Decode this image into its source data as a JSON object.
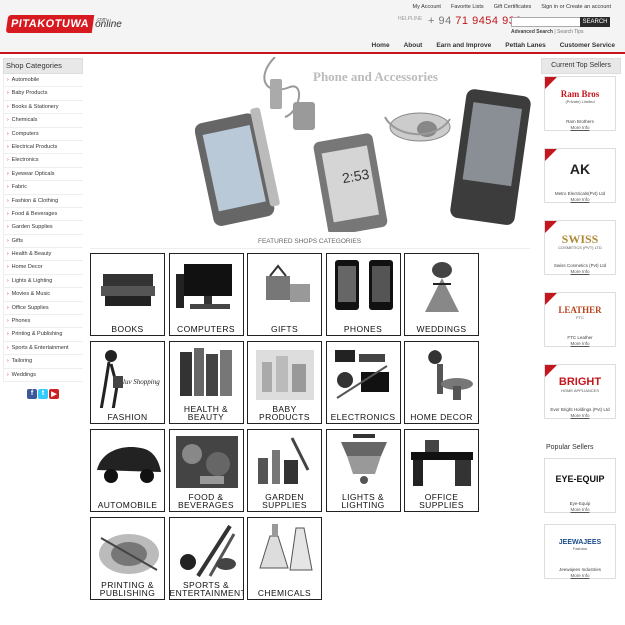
{
  "header": {
    "logo_main": "PITAKOTUWA",
    "logo_sub": "online",
    "logo_com": ".com",
    "top_links": [
      "My Account",
      "Favorite Lists",
      "Gift Certificates",
      "Sign in or Create an account"
    ],
    "helpline_label": "HELPLINE",
    "phone_plus": "+ 94",
    "phone_number": "71 9454 930",
    "search_placeholder": "",
    "search_button": "SEARCH",
    "advanced_search": "Advanced Search",
    "search_tips": "| Search Tips"
  },
  "nav": [
    "Home",
    "About",
    "Earn and Improve",
    "Pettah Lanes",
    "Customer Service"
  ],
  "sidebar": {
    "title": "Shop Categories",
    "items": [
      "Automobile",
      "Baby Products",
      "Books & Stationery",
      "Chemicals",
      "Computers",
      "Electrical Products",
      "Electronics",
      "Eyewear Opticals",
      "Fabric",
      "Fashion & Clothing",
      "Food & Beverages",
      "Garden Supplies",
      "Gifts",
      "Health & Beauty",
      "Home Decor",
      "Lights & Lighting",
      "Movies & Music",
      "Office Supplies",
      "Phones",
      "Printing & Publishing",
      "Sports & Entertainment",
      "Tailoring",
      "Weddings"
    ],
    "social": [
      {
        "icon": "facebook-icon",
        "glyph": "f",
        "color": "#3b5998"
      },
      {
        "icon": "twitter-icon",
        "glyph": "t",
        "color": "#33ccff"
      },
      {
        "icon": "youtube-icon",
        "glyph": "▶",
        "color": "#cc2222"
      }
    ]
  },
  "banner": {
    "title": "Phone and Accessories"
  },
  "featured": {
    "title": "FEATURED SHOPS CATEGORIES"
  },
  "tiles": [
    {
      "l1": "BOOKS",
      "l2": ""
    },
    {
      "l1": "COMPUTERS",
      "l2": ""
    },
    {
      "l1": "GIFTS",
      "l2": ""
    },
    {
      "l1": "PHONES",
      "l2": ""
    },
    {
      "l1": "WEDDINGS",
      "l2": ""
    },
    {
      "l1": "FASHION",
      "l2": ""
    },
    {
      "l1": "HEALTH &",
      "l2": "BEAUTY"
    },
    {
      "l1": "BABY",
      "l2": "PRODUCTS"
    },
    {
      "l1": "ELECTRONICS",
      "l2": ""
    },
    {
      "l1": "HOME DECOR",
      "l2": ""
    },
    {
      "l1": "AUTOMOBILE",
      "l2": ""
    },
    {
      "l1": "FOOD &",
      "l2": "BEVERAGES"
    },
    {
      "l1": "GARDEN",
      "l2": "SUPPLIES"
    },
    {
      "l1": "LIGHTS &",
      "l2": "LIGHTING"
    },
    {
      "l1": "OFFICE",
      "l2": "SUPPLIES"
    },
    {
      "l1": "PRINTING &",
      "l2": "PUBLISHING"
    },
    {
      "l1": "SPORTS &",
      "l2": "ENTERTAINMENT"
    },
    {
      "l1": "CHEMICALS",
      "l2": ""
    }
  ],
  "fashion_script": "luv Shopping",
  "right": {
    "title": "Current Top Sellers",
    "sellers": [
      {
        "logo": "Ram Bros",
        "logo_sub": "(Private) Limited",
        "name": "Ram Brothers",
        "more": "More Info"
      },
      {
        "logo": "AK",
        "logo_sub": "",
        "name": "Metro Electricals(Pvt) Ltd",
        "more": "More Info"
      },
      {
        "logo": "SWISS",
        "logo_sub": "COSMETICS (PVT) LTD",
        "name": "Swiss Cosmetics (Pvt) Ltd",
        "more": "More Info"
      },
      {
        "logo": "LEATHER",
        "logo_sub": "FTC",
        "name": "FTC Leather",
        "more": "More Info"
      },
      {
        "logo": "BRIGHT",
        "logo_sub": "HOME APPLIANCES",
        "name": "Ever Bright Holdings (Pvt) Ltd",
        "more": "More Info"
      }
    ],
    "popular_title": "Popular Sellers",
    "popular": [
      {
        "logo": "EYE-EQUIP",
        "name": "Eye-Equip",
        "more": "More Info"
      },
      {
        "logo": "JEEWAJEES",
        "logo_sub": "Fashion",
        "name": "Jeewajees Industries",
        "more": "More Info"
      }
    ]
  }
}
